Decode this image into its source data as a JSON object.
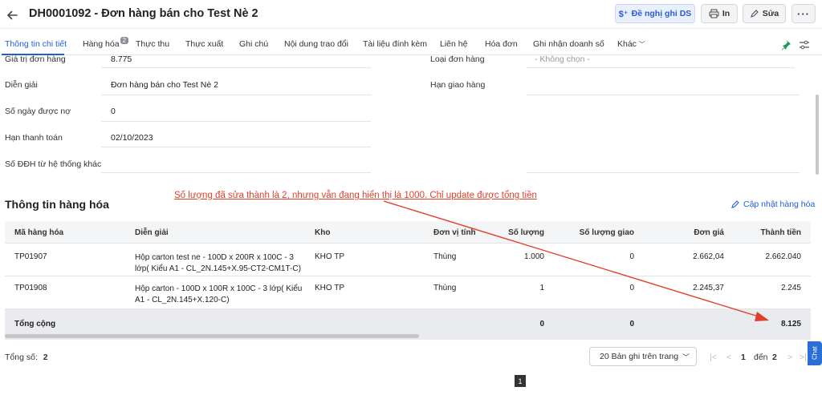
{
  "header": {
    "title": "DH0001092 - Đơn hàng bán cho Test Nè 2",
    "btn_propose": "Đề nghị ghi DS",
    "btn_print": "In",
    "btn_edit": "Sửa"
  },
  "tabs": [
    {
      "label": "Thông tin chi tiết"
    },
    {
      "label": "Hàng hóa",
      "badge": "2"
    },
    {
      "label": "Thực thu"
    },
    {
      "label": "Thực xuất"
    },
    {
      "label": "Ghi chú"
    },
    {
      "label": "Nội dung trao đổi"
    },
    {
      "label": "Tài liệu đính kèm"
    },
    {
      "label": "Liên hệ"
    },
    {
      "label": "Hóa đơn"
    },
    {
      "label": "Ghi nhận doanh số"
    },
    {
      "label": "Khác"
    }
  ],
  "form": {
    "order_value_label": "Giá trị đơn hàng",
    "order_value": "8.775",
    "order_type_label": "Loại đơn hàng",
    "order_type_value": "- Không chọn -",
    "description_label": "Diễn giải",
    "description_value": "Đơn hàng bán cho Test Nè 2",
    "delivery_deadline_label": "Hạn giao hàng",
    "credit_days_label": "Số ngày được nợ",
    "credit_days_value": "0",
    "payment_due_label": "Hạn thanh toán",
    "payment_due_value": "02/10/2023",
    "other_system_label": "Số ĐĐH từ hệ thống khác"
  },
  "goods": {
    "section_title": "Thông tin hàng hóa",
    "update_link": "Cập nhật hàng hóa",
    "annotation": "Số lượng đã sửa thành là 2, nhưng vẫn đang hiển thị là 1000. Chỉ update được tổng tiền",
    "columns": [
      "Mã hàng hóa",
      "Diễn giải",
      "Kho",
      "Đơn vị tính",
      "Số lượng",
      "Số lượng giao",
      "Đơn giá",
      "Thành tiền"
    ],
    "rows": [
      {
        "code": "TP01907",
        "desc1": "Hộp carton test ne - 100D x 200R x 100C - 3",
        "desc2": "lớp( Kiểu A1 - CL_2N.145+X.95-CT2-CM1T-C)",
        "warehouse": "KHO TP",
        "unit": "Thùng",
        "qty": "1.000",
        "qty_delivered": "0",
        "price": "2.662,04",
        "amount": "2.662.040"
      },
      {
        "code": "TP01908",
        "desc1": "Hộp carton - 100D x 100R x 100C - 3 lớp( Kiểu",
        "desc2": "A1 - CL_2N.145+X.120-C)",
        "warehouse": "KHO TP",
        "unit": "Thùng",
        "qty": "1",
        "qty_delivered": "0",
        "price": "2.245,37",
        "amount": "2.245"
      }
    ],
    "total_label": "Tổng cộng",
    "total_qty": "0",
    "total_delivered": "0",
    "total_amount": "8.125"
  },
  "footer": {
    "total_label": "Tổng số:",
    "total_value": "2",
    "page_size": "20 Bản ghi trên trang",
    "page_from": "1",
    "page_to_label": "đến",
    "page_to": "2",
    "page_number": "1"
  },
  "chat_label": "Chat",
  "colors": {
    "accent": "#1f5fd6",
    "annotation": "#e0402b"
  }
}
